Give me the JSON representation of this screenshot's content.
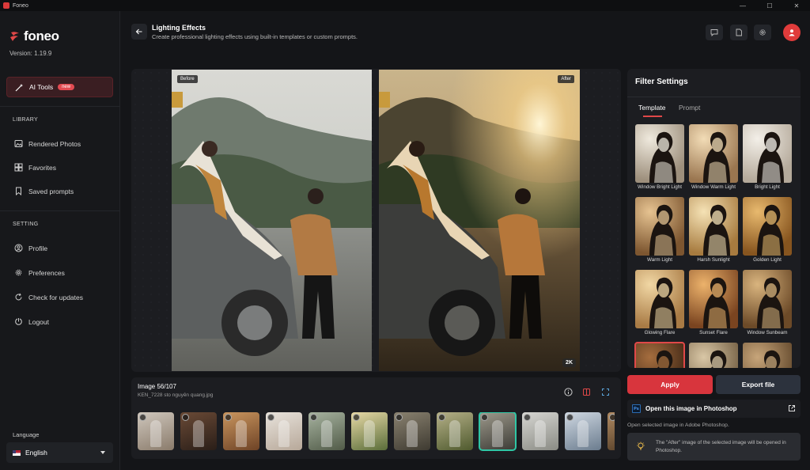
{
  "titlebar": {
    "app_name": "Foneo",
    "minimize": "—",
    "maximize": "☐",
    "close": "✕"
  },
  "brand": {
    "logo_text": "foneo",
    "version": "Version: 1.19.9",
    "accent": "#e04848"
  },
  "sidebar": {
    "ai_tools": {
      "label": "AI Tools",
      "badge": "new"
    },
    "library_heading": "LIBRARY",
    "library_items": [
      {
        "label": "Rendered Photos",
        "icon": "image-icon"
      },
      {
        "label": "Favorites",
        "icon": "grid-icon"
      },
      {
        "label": "Saved prompts",
        "icon": "bookmark-icon"
      }
    ],
    "setting_heading": "SETTING",
    "setting_items": [
      {
        "label": "Profile",
        "icon": "user-icon"
      },
      {
        "label": "Preferences",
        "icon": "gear-icon"
      },
      {
        "label": "Check for updates",
        "icon": "refresh-icon"
      },
      {
        "label": "Logout",
        "icon": "logout-icon"
      }
    ],
    "language_label": "Language",
    "language_value": "English"
  },
  "header": {
    "title": "Lighting Effects",
    "subtitle": "Create professional lighting effects using built-in templates or custom prompts."
  },
  "preview": {
    "before_label": "Before",
    "after_label": "After",
    "resolution_badge": "2K"
  },
  "filmstrip": {
    "count": "Image 56/107",
    "filename": "KEN_7228 sto nguyên quang.jpg",
    "thumbnails": [
      {
        "colors": [
          "#cfc7bd",
          "#8a7b6b"
        ],
        "active": false
      },
      {
        "colors": [
          "#6a4a36",
          "#2a1e18"
        ],
        "active": false
      },
      {
        "colors": [
          "#c9955e",
          "#6e4326"
        ],
        "active": false
      },
      {
        "colors": [
          "#e8e3dc",
          "#b7a899"
        ],
        "active": false
      },
      {
        "colors": [
          "#a7b3a0",
          "#515b48"
        ],
        "active": false
      },
      {
        "colors": [
          "#e7d9a6",
          "#5a6d39"
        ],
        "active": false
      },
      {
        "colors": [
          "#8a8270",
          "#3e3a31"
        ],
        "active": false
      },
      {
        "colors": [
          "#b5b088",
          "#4f5a2e"
        ],
        "active": false
      },
      {
        "colors": [
          "#9e9a8c",
          "#3b3a35"
        ],
        "active": true
      },
      {
        "colors": [
          "#d6d6d2",
          "#8a8b84"
        ],
        "active": false
      },
      {
        "colors": [
          "#cfd8e2",
          "#6b7c8e"
        ],
        "active": false
      },
      {
        "colors": [
          "#b08a62",
          "#4d3823"
        ],
        "active": false
      }
    ]
  },
  "filter_settings": {
    "title": "Filter Settings",
    "tabs": [
      "Template",
      "Prompt"
    ],
    "active_tab": "Template",
    "templates": [
      {
        "label": "Window Bright Light",
        "tone": [
          "#efe9dd",
          "#9d8f7c"
        ]
      },
      {
        "label": "Window Warm Light",
        "tone": [
          "#f2dcb6",
          "#9a7650"
        ]
      },
      {
        "label": "Bright Light",
        "tone": [
          "#f3efe8",
          "#b5aa9b"
        ]
      },
      {
        "label": "Warm Light",
        "tone": [
          "#e6c391",
          "#7d5630"
        ]
      },
      {
        "label": "Harsh Sunlight",
        "tone": [
          "#f5e2b5",
          "#a77b3f"
        ]
      },
      {
        "label": "Golden Light",
        "tone": [
          "#e8b96e",
          "#87551f"
        ]
      },
      {
        "label": "Glowing Flare",
        "tone": [
          "#f1d7a4",
          "#a97b45"
        ]
      },
      {
        "label": "Sunset Flare",
        "tone": [
          "#ecb26b",
          "#7a4420"
        ]
      },
      {
        "label": "Window Sunbeam",
        "tone": [
          "#d9b47e",
          "#6c4a28"
        ]
      },
      {
        "label": "",
        "tone": [
          "#a56d3e",
          "#3d2514"
        ],
        "selected": true
      },
      {
        "label": "",
        "tone": [
          "#d9c7a6",
          "#6f5a3e"
        ]
      },
      {
        "label": "",
        "tone": [
          "#c7a57a",
          "#5f4529"
        ]
      }
    ]
  },
  "actions": {
    "apply": "Apply",
    "export": "Export file",
    "photoshop_title": "Open this image in Photoshop",
    "photoshop_icon_text": "Ps",
    "photoshop_desc": "Open selected image in Adobe Photoshop.",
    "note": "The \"After\" image of the selected image will be opened in Photoshop."
  }
}
